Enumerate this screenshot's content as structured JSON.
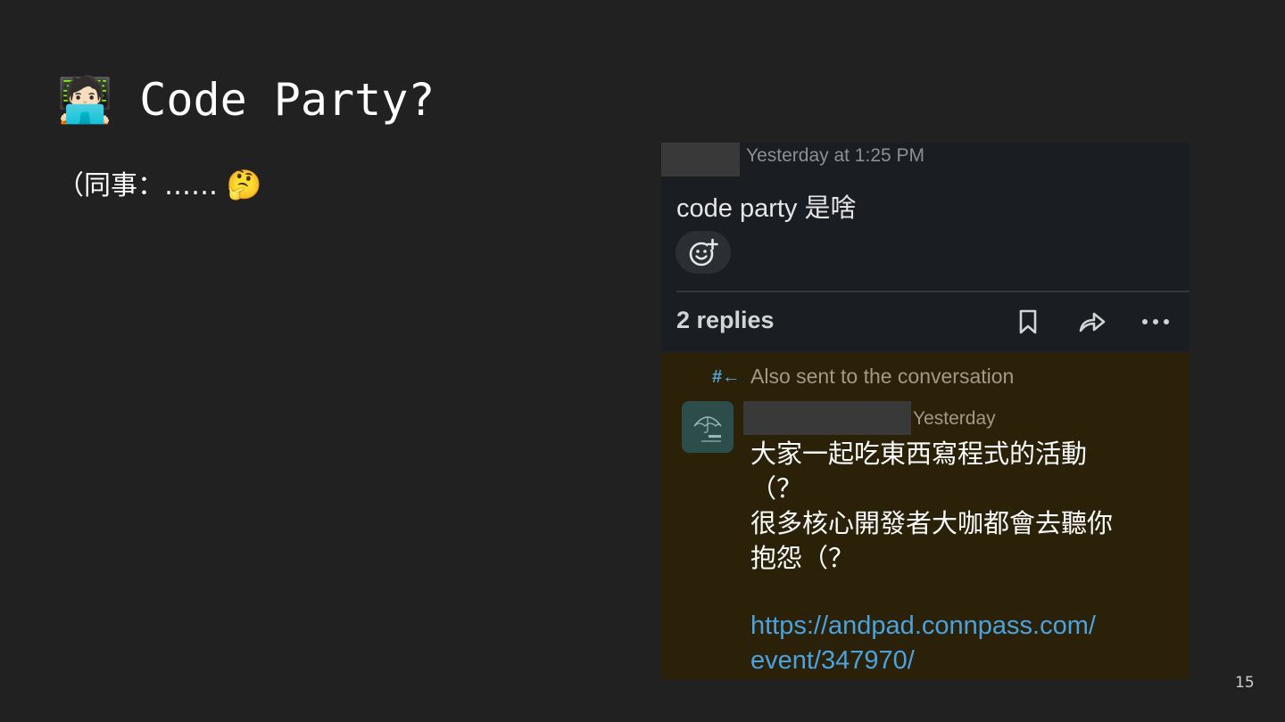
{
  "slide": {
    "title_emoji": "🧑🏻‍💻",
    "title": "Code Party?",
    "subtitle_text": "（同事：……",
    "subtitle_emoji": "🤔",
    "page_number": "15"
  },
  "screenshot": {
    "timestamp_1": "Yesterday at 1:25 PM",
    "message": "code party 是啥",
    "add_reaction_icon": "smiley-plus-icon",
    "replies_label": "2 replies",
    "actions": [
      "bookmark-icon",
      "share-icon",
      "more-icon"
    ],
    "channel_icon": "#←",
    "also_sent": "Also sent to the conversation",
    "timestamp_2": "Yesterday",
    "reply_lines": [
      "大家一起吃東西寫程式的活動",
      "（？",
      "很多核心開發者大咖都會去聽你",
      "抱怨（？"
    ],
    "link_lines": [
      "https://andpad.connpass.com/",
      "event/347970/"
    ]
  },
  "colors": {
    "slide_bg": "#212121",
    "thread_bg": "#1a1d21",
    "highlight_bg": "#2b2008",
    "link": "#4aa3df"
  }
}
